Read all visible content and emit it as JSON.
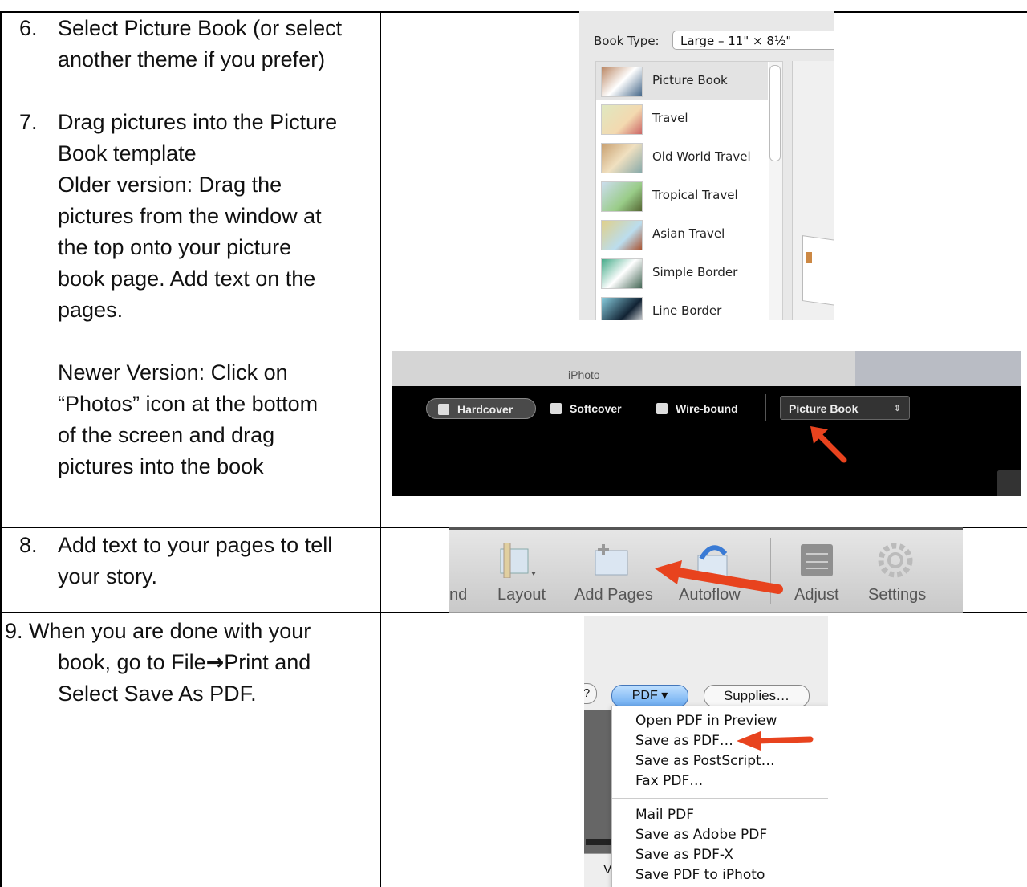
{
  "rows": [
    {
      "number": "6.",
      "lines": [
        "Select Picture Book (or select",
        "another theme if you prefer)"
      ]
    },
    {
      "number": "7.",
      "lines": [
        "Drag pictures into the Picture",
        "Book template",
        "Older version: Drag the",
        "pictures from the window at",
        "the top onto your picture",
        "book page. Add text on the",
        "pages."
      ],
      "lines2": [
        "Newer Version:  Click on",
        "“Photos” icon at the bottom",
        "of the screen and drag",
        "pictures into the book"
      ]
    },
    {
      "number": "8.",
      "lines": [
        "Add text to your pages to tell",
        "your story."
      ]
    },
    {
      "number": "9.",
      "first": "When you are done with your",
      "line2_a": "book, go to File",
      "line2_arrow": "→",
      "line2_b": "Print and",
      "line3": "Select Save As PDF."
    }
  ],
  "book_type_panel": {
    "label": "Book Type:",
    "selected": "Large – 11\" × 8½\"",
    "themes": [
      "Picture Book",
      "Travel",
      "Old World Travel",
      "Tropical Travel",
      "Asian Travel",
      "Simple Border",
      "Line Border"
    ],
    "selected_theme": "Picture Book"
  },
  "iphoto_toolbar": {
    "window_title": "iPhoto",
    "options": [
      "Hardcover",
      "Softcover",
      "Wire-bound"
    ],
    "theme_select": "Picture Book"
  },
  "edit_toolbar": {
    "tools": [
      "nd",
      "Layout",
      "Add Pages",
      "Autoflow",
      "Adjust",
      "Settings"
    ]
  },
  "print_dialog": {
    "help": "?",
    "pdf_button": "PDF ▾",
    "supplies_button": "Supplies…",
    "menu_group1": [
      "Open PDF in Preview",
      "Save as PDF…",
      "Save as PostScript…",
      "Fax PDF…"
    ],
    "menu_group2": [
      "Mail PDF",
      "Save as Adobe PDF",
      "Save as PDF-X",
      "Save PDF to iPhoto"
    ],
    "bg_fragment": "V"
  },
  "colors": {
    "arrow": "#e8431e",
    "pdf_button": "#7ab4f2"
  }
}
